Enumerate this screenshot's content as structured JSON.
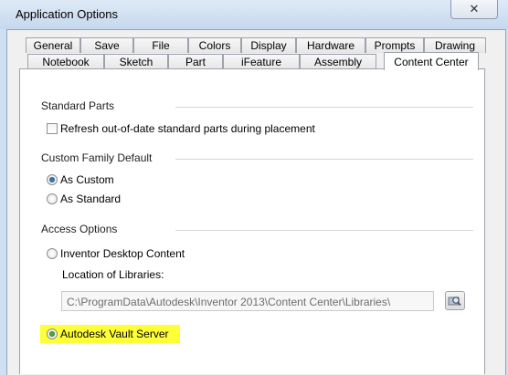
{
  "window": {
    "title": "Application Options",
    "close_glyph": "✕"
  },
  "tabs_row1": [
    "General",
    "Save",
    "File",
    "Colors",
    "Display",
    "Hardware",
    "Prompts",
    "Drawing"
  ],
  "tabs_row2": [
    "Notebook",
    "Sketch",
    "Part",
    "iFeature",
    "Assembly",
    "Content Center"
  ],
  "active_tab": "Content Center",
  "standard_parts": {
    "heading": "Standard Parts",
    "refresh_label": "Refresh out-of-date standard parts during placement",
    "refresh_checked": false
  },
  "custom_family": {
    "heading": "Custom Family Default",
    "options": [
      {
        "label": "As Custom",
        "checked": true
      },
      {
        "label": "As Standard",
        "checked": false
      }
    ]
  },
  "access_options": {
    "heading": "Access Options",
    "desktop_label": "Inventor Desktop Content",
    "desktop_checked": false,
    "location_label": "Location of Libraries:",
    "location_value": "C:\\ProgramData\\Autodesk\\Inventor 2013\\Content Center\\Libraries\\",
    "vault_label": "Autodesk Vault Server",
    "vault_checked": true,
    "vault_highlight_color": "#ffff38"
  },
  "icons": {
    "browse": "folder-browse-icon"
  }
}
